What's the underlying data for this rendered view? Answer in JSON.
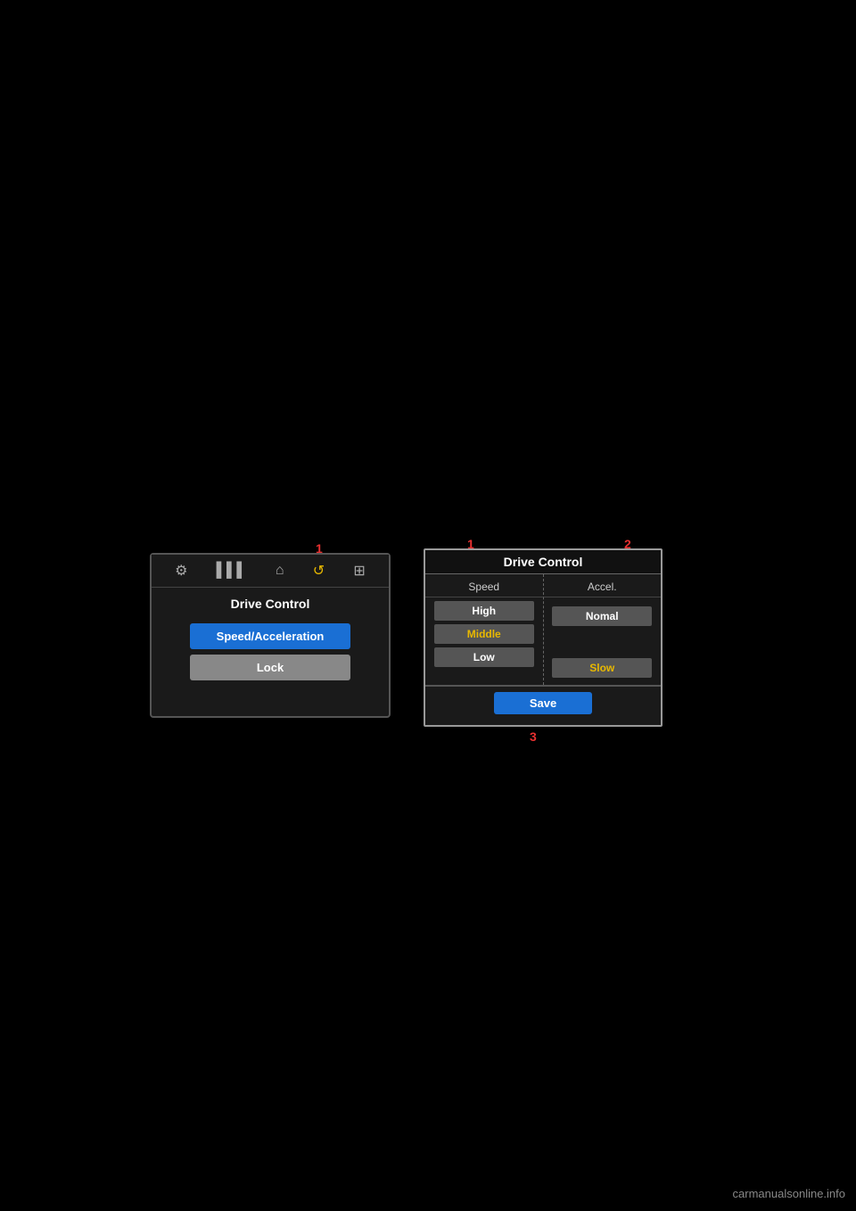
{
  "page": {
    "background": "#000000"
  },
  "left_panel": {
    "title": "Drive Control",
    "nav_icons": [
      "⚙",
      "||||",
      "⌂",
      "↺",
      "⊞"
    ],
    "active_nav_index": 3,
    "buttons": [
      {
        "label": "Speed/Acceleration",
        "style": "blue"
      },
      {
        "label": "Lock",
        "style": "gray"
      }
    ]
  },
  "right_panel": {
    "title": "Drive Control",
    "col_speed_header": "Speed",
    "col_accel_header": "Accel.",
    "speed_options": [
      {
        "label": "High",
        "style": "normal"
      },
      {
        "label": "Middle",
        "style": "highlighted"
      },
      {
        "label": "Low",
        "style": "normal"
      }
    ],
    "accel_options": [
      {
        "label": "Nomal",
        "style": "normal"
      },
      {
        "label": "Slow",
        "style": "highlighted"
      }
    ],
    "save_button_label": "Save"
  },
  "annotations": {
    "left_1": "1",
    "right_1": "1",
    "right_2": "2",
    "right_3": "3"
  },
  "watermark": "carmanualsonline.info"
}
